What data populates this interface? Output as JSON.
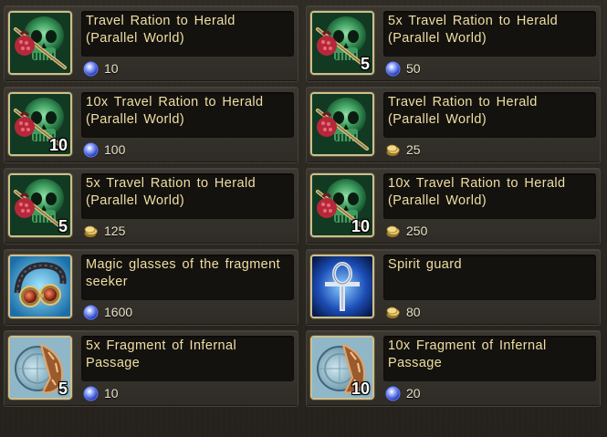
{
  "colors": {
    "item_name": "#f0dfa3",
    "price_text": "#e9e2c9",
    "frame_gold": "#cdbf8e",
    "gem_blue": "#4f74ff",
    "coin_gold": "#e7c66a"
  },
  "items": [
    {
      "name": "Travel Ration to Herald (Parallel World)",
      "quantity": "",
      "icon": "skull-ration-icon",
      "currency": "gem-icon",
      "price": "10"
    },
    {
      "name": "5x Travel Ration to Herald (Parallel World)",
      "quantity": "5",
      "icon": "skull-ration-icon",
      "currency": "gem-icon",
      "price": "50"
    },
    {
      "name": "10x Travel Ration to Herald (Parallel World)",
      "quantity": "10",
      "icon": "skull-ration-icon",
      "currency": "gem-icon",
      "price": "100"
    },
    {
      "name": "Travel Ration to Herald (Parallel World)",
      "quantity": "",
      "icon": "skull-ration-icon",
      "currency": "gold-coin-icon",
      "price": "25"
    },
    {
      "name": "5x Travel Ration to Herald (Parallel World)",
      "quantity": "5",
      "icon": "skull-ration-icon",
      "currency": "gold-coin-icon",
      "price": "125"
    },
    {
      "name": "10x Travel Ration to Herald (Parallel World)",
      "quantity": "10",
      "icon": "skull-ration-icon",
      "currency": "gold-coin-icon",
      "price": "250"
    },
    {
      "name": "Magic glasses of the fragment seeker",
      "quantity": "",
      "icon": "goggles-icon",
      "currency": "gem-icon",
      "price": "1600"
    },
    {
      "name": "Spirit guard",
      "quantity": "",
      "icon": "ankh-icon",
      "currency": "gold-coin-icon",
      "price": "80"
    },
    {
      "name": "5x Fragment of Infernal Passage",
      "quantity": "5",
      "icon": "fragment-icon",
      "currency": "gem-icon",
      "price": "10"
    },
    {
      "name": "10x Fragment of Infernal Passage",
      "quantity": "10",
      "icon": "fragment-icon",
      "currency": "gem-icon",
      "price": "20"
    }
  ]
}
